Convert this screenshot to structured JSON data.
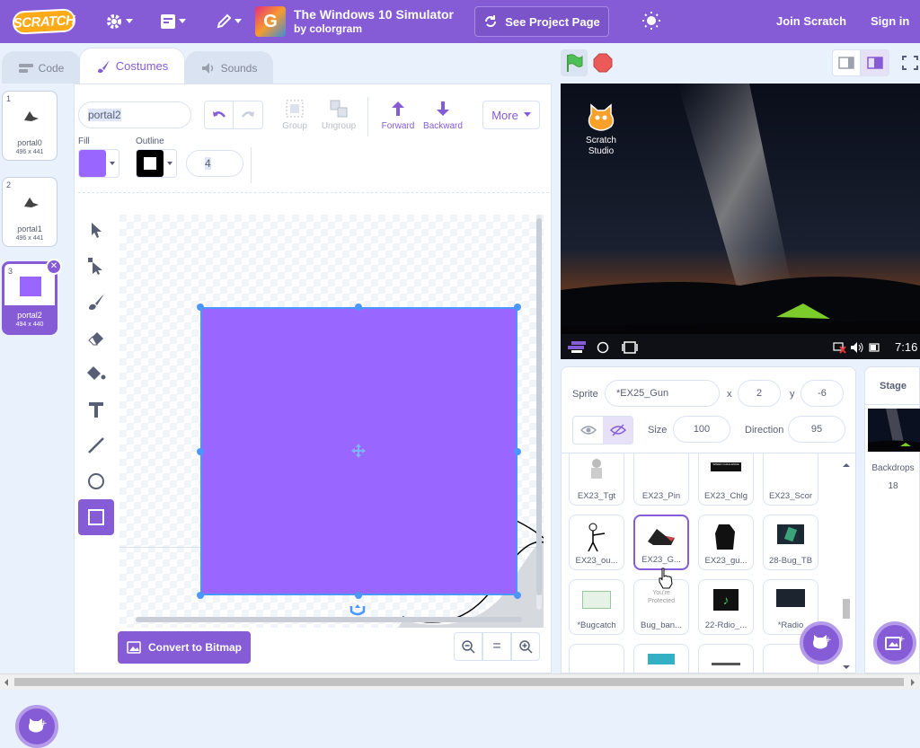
{
  "menubar": {
    "logo": "SCRATCH",
    "project_title": "The Windows 10 Simulator",
    "project_author": "by colorgram",
    "thumb_letter": "G",
    "see_project": "See Project Page",
    "join": "Join Scratch",
    "signin": "Sign in"
  },
  "tabs": {
    "code": "Code",
    "costumes": "Costumes",
    "sounds": "Sounds"
  },
  "costumes": [
    {
      "num": "1",
      "name": "portal0",
      "dims": "496 x 441"
    },
    {
      "num": "2",
      "name": "portal1",
      "dims": "496 x 441"
    },
    {
      "num": "3",
      "name": "portal2",
      "dims": "494 x 440"
    }
  ],
  "editor": {
    "costume_name": "portal2",
    "fill_label": "Fill",
    "outline_label": "Outline",
    "outline_width": "4",
    "group": "Group",
    "ungroup": "Ungroup",
    "forward": "Forward",
    "backward": "Backward",
    "more": "More",
    "convert": "Convert to Bitmap",
    "zoom_reset": "=",
    "fill_color": "#9966ff",
    "outline_color": "#000000"
  },
  "stage": {
    "desktop_icon_label": "Scratch Studio",
    "clock": "7:16"
  },
  "sprite_info": {
    "sprite_label": "Sprite",
    "sprite_name": "*EX25_Gun",
    "x_label": "x",
    "x": "2",
    "y_label": "y",
    "y": "-6",
    "size_label": "Size",
    "size": "100",
    "direction_label": "Direction",
    "direction": "95"
  },
  "sprites": [
    {
      "name": "EX23_Tgt"
    },
    {
      "name": "EX23_Pin"
    },
    {
      "name": "EX23_Chlg"
    },
    {
      "name": "EX23_Scor"
    },
    {
      "name": "EX23_ou..."
    },
    {
      "name": "EX23_G..."
    },
    {
      "name": "EX23_gu..."
    },
    {
      "name": "28-Bug_TB"
    },
    {
      "name": "*Bugcatch"
    },
    {
      "name": "Bug_ban..."
    },
    {
      "name": "22-Rdio_..."
    },
    {
      "name": "*Radio"
    }
  ],
  "tile_texts": {
    "chlg": "SPEED CHALLENGE",
    "protected": "You're Protected"
  },
  "stage_panel": {
    "title": "Stage",
    "backdrops_label": "Backdrops",
    "backdrops_count": "18"
  }
}
